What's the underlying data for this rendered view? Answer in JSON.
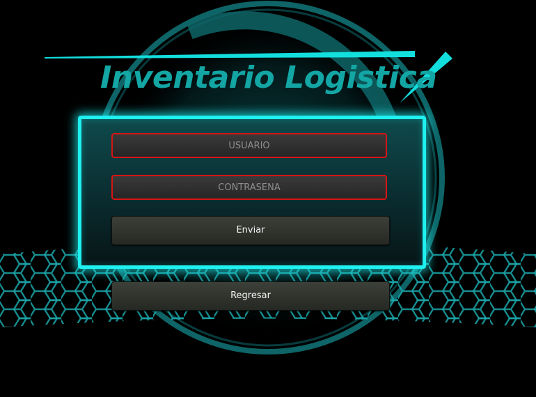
{
  "app": {
    "title": "Inventario Logistica"
  },
  "login_form": {
    "username_placeholder": "USUARIO",
    "username_value": "",
    "password_placeholder": "CONTRASEÑA",
    "password_value": "",
    "submit_label": "Enviar"
  },
  "back_button": {
    "label": "Regresar"
  },
  "colors": {
    "accent_cyan": "#1ff0f0",
    "title_teal": "#13a6a4",
    "field_border_red": "#d81414",
    "button_dark": "#30342e",
    "background": "#000000"
  },
  "decorations": {
    "background_icon": "circle-ring-hexagon-grid"
  }
}
